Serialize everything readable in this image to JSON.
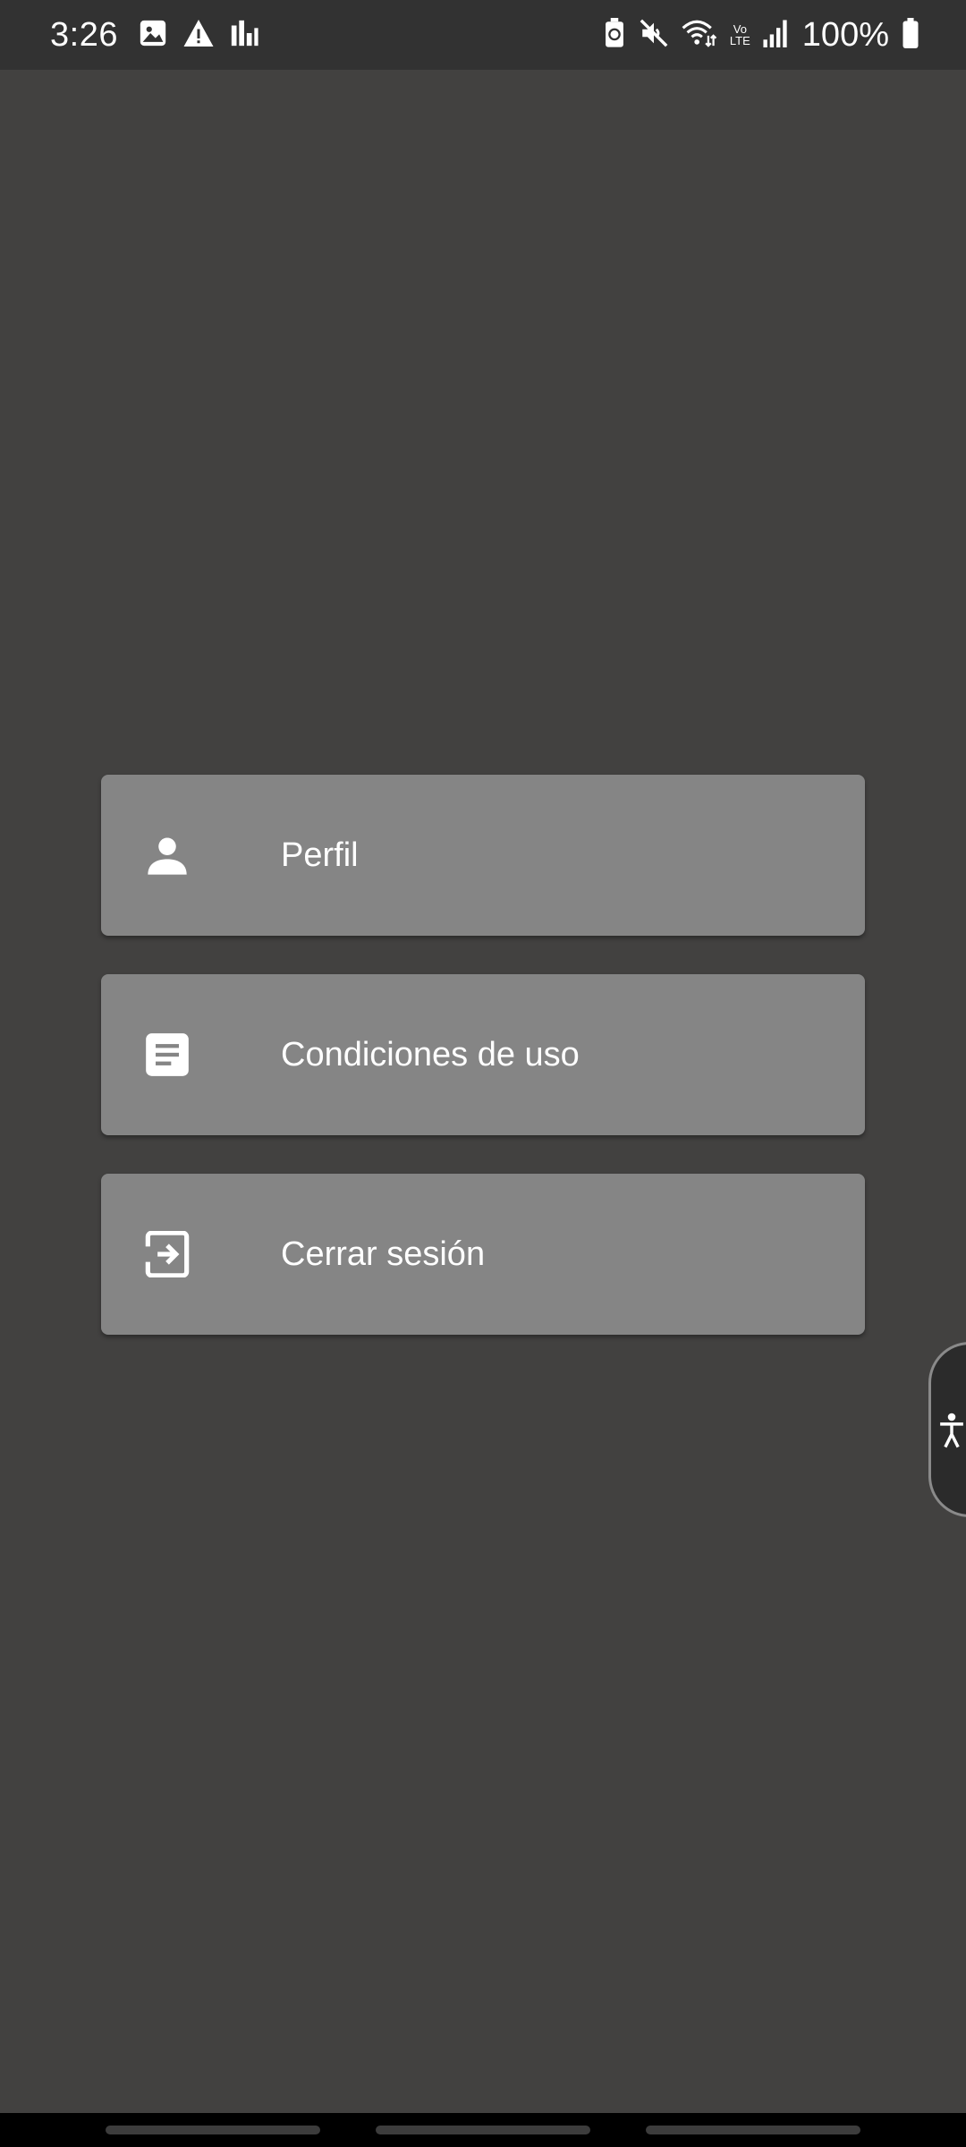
{
  "status_bar": {
    "time": "3:26",
    "battery_text": "100%",
    "left_icons": [
      "gallery-icon",
      "warning-icon",
      "bar-chart-icon"
    ],
    "right_icons": [
      "battery-saver-icon",
      "mute-icon",
      "wifi-icon",
      "volte-icon",
      "signal-icon",
      "battery-icon"
    ],
    "volte_top": "Vo",
    "volte_bottom": "LTE"
  },
  "menu": {
    "items": [
      {
        "label": "Perfil",
        "icon": "person-icon"
      },
      {
        "label": "Condiciones de uso",
        "icon": "document-icon"
      },
      {
        "label": "Cerrar sesión",
        "icon": "logout-icon"
      }
    ]
  },
  "accessibility_tab": {
    "icon": "accessibility-icon"
  },
  "colors": {
    "background": "#424140",
    "status_bar": "#323232",
    "button": "#858585",
    "text": "#ffffff"
  }
}
